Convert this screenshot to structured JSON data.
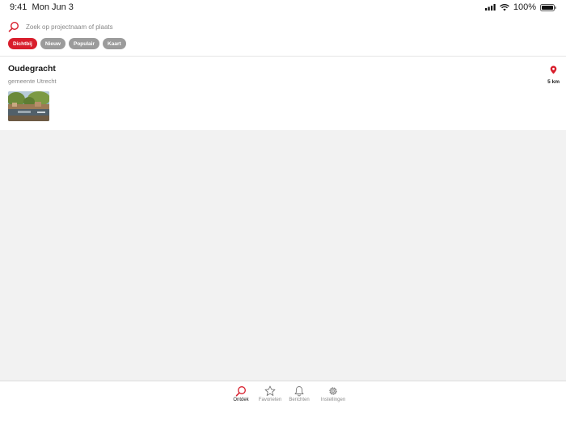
{
  "status_bar": {
    "time": "9:41",
    "date": "Mon Jun 3",
    "battery": "100%"
  },
  "search": {
    "placeholder": "Zoek op projectnaam of plaats",
    "value": ""
  },
  "filters": [
    {
      "label": "Dichtbij",
      "active": true
    },
    {
      "label": "Nieuw",
      "active": false
    },
    {
      "label": "Populair",
      "active": false
    },
    {
      "label": "Kaart",
      "active": false
    }
  ],
  "projects": [
    {
      "title": "Oudegracht",
      "municipality": "gemeente Utrecht",
      "distance": "5 km",
      "image": "canal-photo"
    }
  ],
  "tabbar": {
    "items": [
      {
        "label": "Ontdek",
        "icon": "search-icon",
        "active": true
      },
      {
        "label": "Favorieten",
        "icon": "star-icon",
        "active": false
      },
      {
        "label": "Berichten",
        "icon": "bell-icon",
        "active": false
      },
      {
        "label": "Instellingen",
        "icon": "gear-icon",
        "active": false
      }
    ]
  },
  "colors": {
    "accent": "#d81e2c",
    "chip_inactive": "#9b9b9b",
    "background": "#f2f2f2"
  }
}
